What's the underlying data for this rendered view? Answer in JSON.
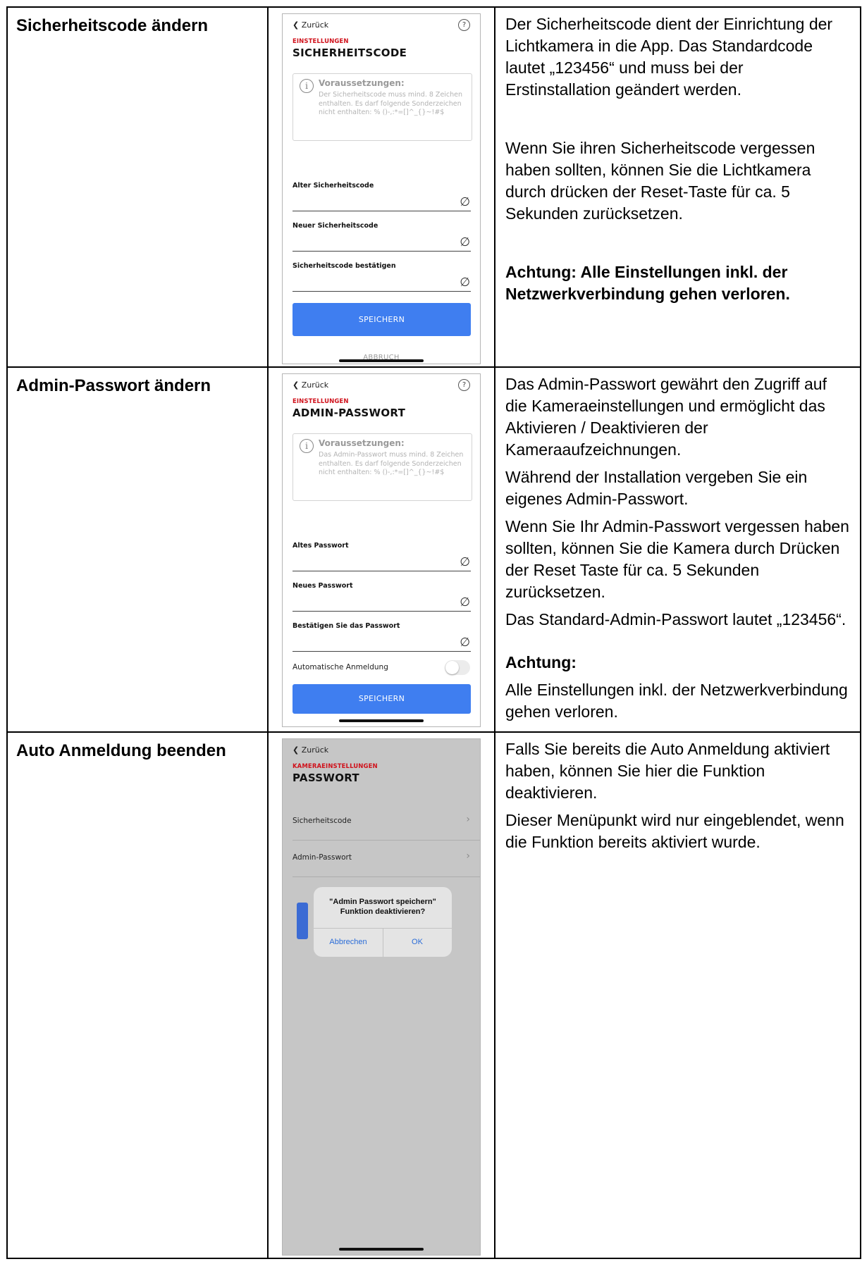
{
  "rows": [
    {
      "title": "Sicherheitscode ändern",
      "phone": {
        "back": "Zurück",
        "help": "?",
        "kicker": "EINSTELLUNGEN",
        "title": "SICHERHEITSCODE",
        "info_head": "Voraussetzungen:",
        "info_text": "Der Sicherheitscode muss mind. 8 Zeichen enthalten. Es darf folgende Sonderzeichen nicht enthalten: % ()-,:*=[]^_{}~!#$",
        "fields": [
          "Alter Sicherheitscode",
          "Neuer Sicherheitscode",
          "Sicherheitscode bestätigen"
        ],
        "save": "SPEICHERN",
        "cancel": "ABBRUCH"
      },
      "desc": {
        "p1": "Der Sicherheitscode dient der Einrichtung der Lichtkamera in die App.  Das Standardcode lautet „123456“ und muss bei der Erstinstallation geändert werden.",
        "p2": "Wenn Sie ihren Sicherheitscode vergessen haben sollten, können Sie die Lichtkamera durch drücken der Reset-Taste für ca. 5 Sekunden zurücksetzen.",
        "p3": "Achtung:  Alle Einstellungen inkl. der Netzwerkverbindung gehen verloren."
      }
    },
    {
      "title": "Admin-Passwort ändern",
      "phone": {
        "back": "Zurück",
        "help": "?",
        "kicker": "EINSTELLUNGEN",
        "title": "ADMIN-PASSWORT",
        "info_head": "Voraussetzungen:",
        "info_text": "Das Admin-Passwort muss mind. 8 Zeichen enthalten. Es darf folgende Sonderzeichen nicht enthalten: % ()-,:*=[]^_{}~!#$",
        "fields": [
          "Altes Passwort",
          "Neues Passwort",
          "Bestätigen Sie das Passwort"
        ],
        "toggle_label": "Automatische Anmeldung",
        "toggle_on": false,
        "save": "SPEICHERN"
      },
      "desc": {
        "p1": "Das Admin-Passwort gewährt den Zugriff auf die Kameraeinstellungen und ermöglicht das Aktivieren / Deaktivieren der Kameraaufzeichnungen.",
        "p2": "Während der Installation vergeben Sie ein eigenes Admin-Passwort.",
        "p3": "Wenn Sie Ihr Admin-Passwort vergessen haben sollten, können Sie die Kamera durch Drücken der Reset Taste für ca. 5 Sekunden zurücksetzen.",
        "p4": "Das Standard-Admin-Passwort lautet „123456“.",
        "p5": "Achtung:",
        "p6": "Alle Einstellungen inkl. der Netzwerkverbindung gehen verloren."
      }
    },
    {
      "title": "Auto Anmeldung beenden",
      "phone": {
        "back": "Zurück",
        "kicker": "KAMERAEINSTELLUNGEN",
        "title": "PASSWORT",
        "menu": [
          "Sicherheitscode",
          "Admin-Passwort"
        ],
        "dialog_line1": "\"Admin Passwort speichern\"",
        "dialog_line2": "Funktion deaktivieren?",
        "dialog_cancel": "Abbrechen",
        "dialog_ok": "OK"
      },
      "desc": {
        "p1": "Falls Sie bereits die Auto Anmeldung aktiviert haben, können Sie hier die Funktion deaktivieren.",
        "p2": "Dieser Menüpunkt wird nur eingeblendet, wenn die Funktion bereits aktiviert wurde."
      }
    }
  ],
  "colors": {
    "accent_red": "#d0111b",
    "button_blue": "#3f7ef0",
    "dialog_link": "#2a6cd8",
    "overlay_gray": "#c6c6c6"
  },
  "icons": [
    "chevron-left-icon",
    "help-icon",
    "info-icon",
    "eye-off-icon",
    "chevron-right-icon"
  ]
}
